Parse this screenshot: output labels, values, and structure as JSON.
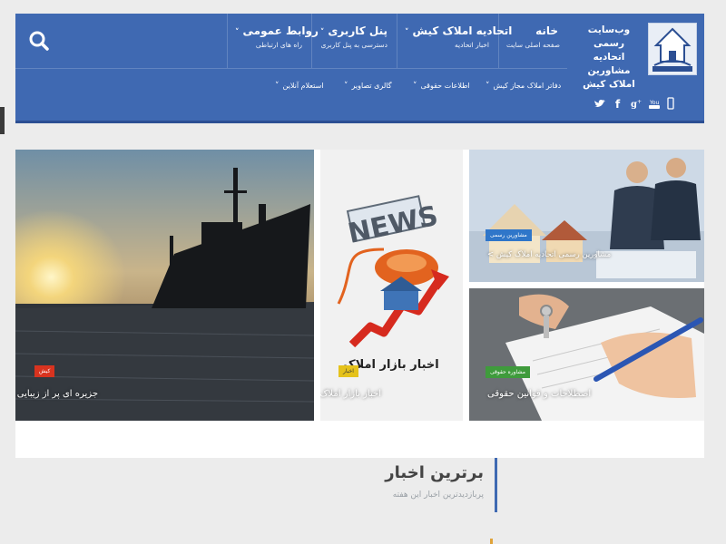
{
  "header": {
    "brand_line1": "وب‌سایت رسمی",
    "brand_line2": "اتحادیه مشاورین",
    "brand_line3": "املاک کیش",
    "logo_text": "اتحادیه مشاورین املاک کیش",
    "nav": [
      {
        "title": "خانه",
        "subtitle": "صفحه اصلی سایت"
      },
      {
        "title": "اتحادیه املاک کیش",
        "subtitle": "اخبار اتحادیه"
      },
      {
        "title": "پنل کاربری",
        "subtitle": "دسترسی به پنل کاربری"
      },
      {
        "title": "روابط عمومی",
        "subtitle": "راه های ارتباطی"
      }
    ],
    "subnav": [
      "دفاتر املاک مجاز کیش",
      "اطلاعات حقوقی",
      "گالری تصاویر",
      "استعلام آنلاین"
    ],
    "chevron": "˅",
    "search_icon": "search-icon",
    "social_icons": [
      "mobile-icon",
      "youtube-icon",
      "google-plus-icon",
      "facebook-icon",
      "twitter-icon"
    ],
    "colors": {
      "header_bg": "#3f69b2"
    }
  },
  "tiles": [
    {
      "badge": "کیش",
      "caption": "جزیره ای پر از زیبایی",
      "badge_color": "#d8331f"
    },
    {
      "badge": "اخبار",
      "caption": "اخبار بازار املاک",
      "badge_color": "#e5c21b",
      "image_text": "اخبار بازار املاک",
      "news_word": "NEWS"
    },
    {
      "badge": "مشاورین رسمی",
      "caption": "< مشاورین رسمی اتحادیه املاک کیش",
      "badge_color": "#2f76c9"
    },
    {
      "badge": "مشاوره حقوقی",
      "caption": "اصطلاحات و قوانین حقوقی",
      "badge_color": "#3f9b3c"
    }
  ],
  "top_news": {
    "title": "برترین اخبار",
    "subtitle": "پربازدیدترین اخبار این هفته"
  }
}
